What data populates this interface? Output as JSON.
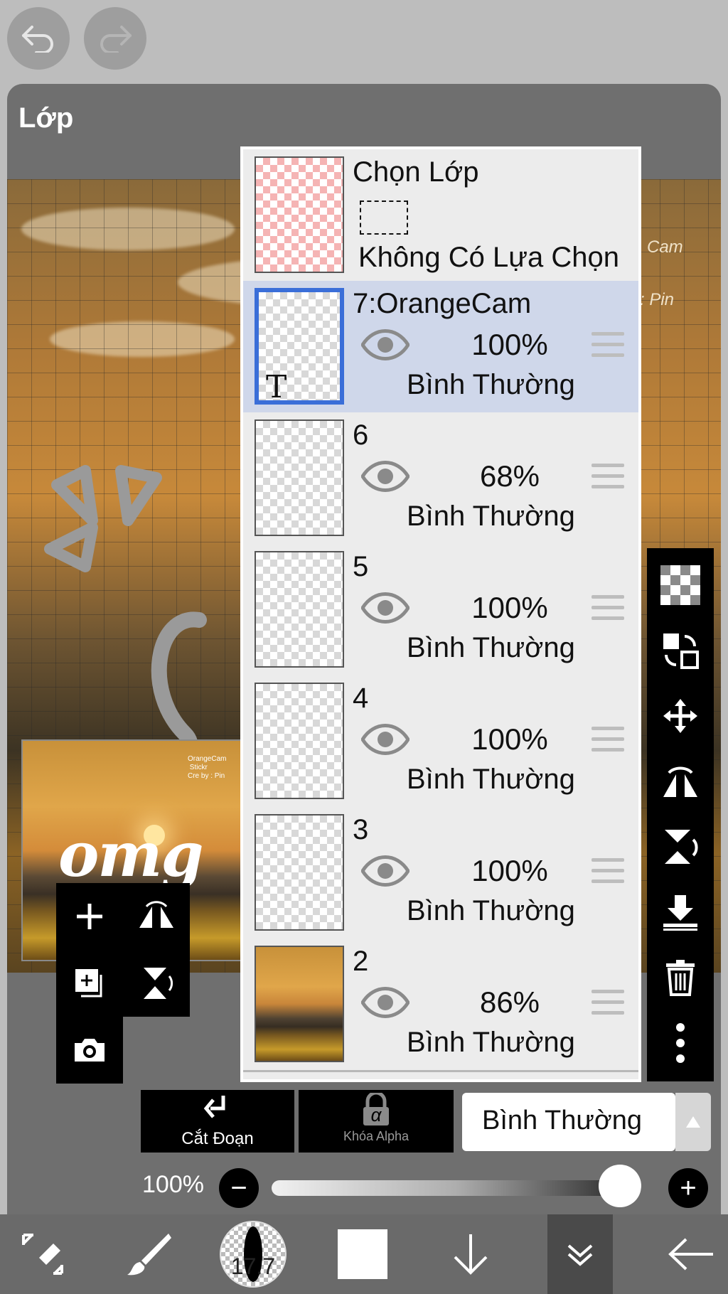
{
  "header": {
    "undo_icon": "undo-arrow-icon",
    "redo_icon": "redo-arrow-icon"
  },
  "sheet": {
    "title": "Lớp"
  },
  "canvas": {
    "watermark_1": "Cam",
    "watermark_2": ": Pin"
  },
  "preview": {
    "text": "omg",
    "small_text": "OrangeCam\n Stickr\nCre by : Pin"
  },
  "selection_row": {
    "title": "Chọn Lớp",
    "status": "Không Có Lựa Chọn"
  },
  "layers": [
    {
      "name": "7:OrangeCam",
      "opacity": "100%",
      "blend": "Bình Thường",
      "selected": true,
      "thumb_text": "T"
    },
    {
      "name": "6",
      "opacity": "68%",
      "blend": "Bình Thường",
      "selected": false
    },
    {
      "name": "5",
      "opacity": "100%",
      "blend": "Bình Thường",
      "selected": false
    },
    {
      "name": "4",
      "opacity": "100%",
      "blend": "Bình Thường",
      "selected": false
    },
    {
      "name": "3",
      "opacity": "100%",
      "blend": "Bình Thường",
      "selected": false
    },
    {
      "name": "2",
      "opacity": "86%",
      "blend": "Bình Thường",
      "selected": false
    }
  ],
  "controls": {
    "clip_label": "Cắt Đoạn",
    "alpha_lock_label": "Khóa Alpha",
    "alpha_symbol": "α",
    "blend_mode": "Bình Thường",
    "opacity_label": "100%",
    "opacity_value": 100,
    "minus": "−",
    "plus": "+"
  },
  "bottombar": {
    "brush_size": "17.7"
  },
  "colors": {
    "accent": "#3a6ed8",
    "selected_row": "#cfd7ea",
    "sheet": "#6f6f6f",
    "toolbar": "#000000"
  }
}
